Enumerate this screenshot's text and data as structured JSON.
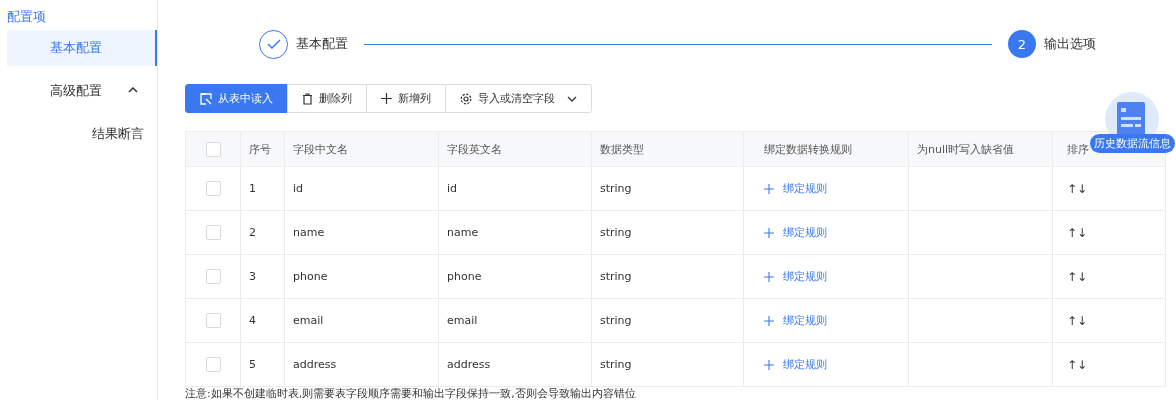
{
  "sidebar": {
    "title": "配置项",
    "items": [
      {
        "label": "基本配置",
        "selected": true
      },
      {
        "label": "高级配置",
        "selected": false,
        "expanded": true,
        "children": [
          {
            "label": "结果断言",
            "selected": false
          }
        ]
      }
    ]
  },
  "steps": [
    {
      "label": "基本配置",
      "completed": true
    },
    {
      "label": "输出选项",
      "completed": false,
      "number": "2"
    }
  ],
  "toolbar": [
    {
      "label": "从表中读入",
      "kind": "primary"
    },
    {
      "label": "删除列",
      "kind": "default"
    },
    {
      "label": "新增列",
      "kind": "default"
    },
    {
      "label": "导入或清空字段",
      "kind": "default",
      "dropdown": true
    }
  ],
  "table": {
    "all_checked": false,
    "columns": [
      "序号",
      "字段中文名",
      "字段英文名",
      "数据类型",
      "绑定数据转换规则",
      "为null时写入缺省值",
      "排序"
    ],
    "rows": [
      {
        "checked": false,
        "index": "1",
        "cn_name": "id",
        "en_name": "id",
        "type": "string",
        "rule": "绑定规则",
        "sort": "↑↓"
      },
      {
        "checked": false,
        "index": "2",
        "cn_name": "name",
        "en_name": "name",
        "type": "string",
        "rule": "绑定规则",
        "sort": "↑↓"
      },
      {
        "checked": false,
        "index": "3",
        "cn_name": "phone",
        "en_name": "phone",
        "type": "string",
        "rule": "绑定规则",
        "sort": "↑↓"
      },
      {
        "checked": false,
        "index": "4",
        "cn_name": "email",
        "en_name": "email",
        "type": "string",
        "rule": "绑定规则",
        "sort": "↑↓"
      },
      {
        "checked": false,
        "index": "5",
        "cn_name": "address",
        "en_name": "address",
        "type": "string",
        "rule": "绑定规则",
        "sort": "↑↓"
      }
    ]
  },
  "note": "注意:如果不创建临时表,则需要表字段顺序需要和输出字段保持一致,否则会导致输出内容错位",
  "float_button": {
    "label": "历史数据流信息"
  }
}
